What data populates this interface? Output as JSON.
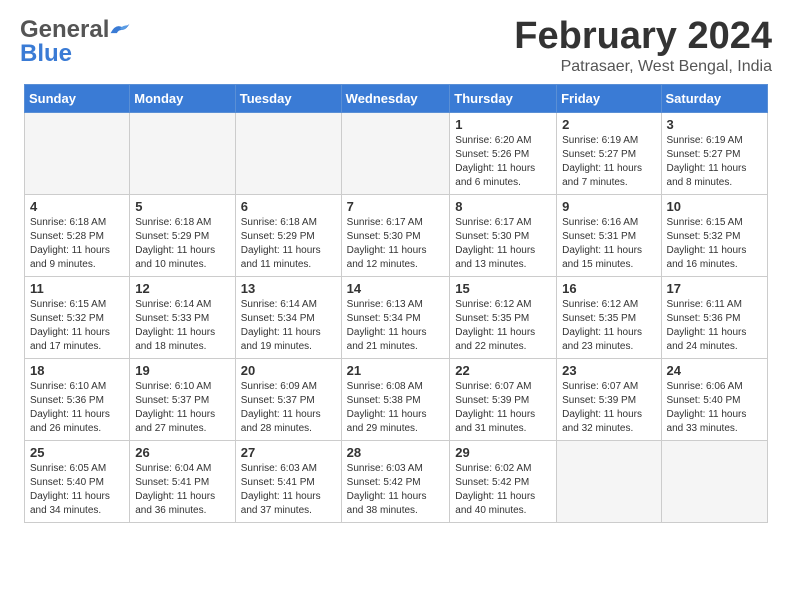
{
  "header": {
    "logo_line1": "General",
    "logo_line2": "Blue",
    "month_title": "February 2024",
    "location": "Patrasaer, West Bengal, India"
  },
  "weekdays": [
    "Sunday",
    "Monday",
    "Tuesday",
    "Wednesday",
    "Thursday",
    "Friday",
    "Saturday"
  ],
  "weeks": [
    [
      {
        "day": "",
        "info": ""
      },
      {
        "day": "",
        "info": ""
      },
      {
        "day": "",
        "info": ""
      },
      {
        "day": "",
        "info": ""
      },
      {
        "day": "1",
        "info": "Sunrise: 6:20 AM\nSunset: 5:26 PM\nDaylight: 11 hours\nand 6 minutes."
      },
      {
        "day": "2",
        "info": "Sunrise: 6:19 AM\nSunset: 5:27 PM\nDaylight: 11 hours\nand 7 minutes."
      },
      {
        "day": "3",
        "info": "Sunrise: 6:19 AM\nSunset: 5:27 PM\nDaylight: 11 hours\nand 8 minutes."
      }
    ],
    [
      {
        "day": "4",
        "info": "Sunrise: 6:18 AM\nSunset: 5:28 PM\nDaylight: 11 hours\nand 9 minutes."
      },
      {
        "day": "5",
        "info": "Sunrise: 6:18 AM\nSunset: 5:29 PM\nDaylight: 11 hours\nand 10 minutes."
      },
      {
        "day": "6",
        "info": "Sunrise: 6:18 AM\nSunset: 5:29 PM\nDaylight: 11 hours\nand 11 minutes."
      },
      {
        "day": "7",
        "info": "Sunrise: 6:17 AM\nSunset: 5:30 PM\nDaylight: 11 hours\nand 12 minutes."
      },
      {
        "day": "8",
        "info": "Sunrise: 6:17 AM\nSunset: 5:30 PM\nDaylight: 11 hours\nand 13 minutes."
      },
      {
        "day": "9",
        "info": "Sunrise: 6:16 AM\nSunset: 5:31 PM\nDaylight: 11 hours\nand 15 minutes."
      },
      {
        "day": "10",
        "info": "Sunrise: 6:15 AM\nSunset: 5:32 PM\nDaylight: 11 hours\nand 16 minutes."
      }
    ],
    [
      {
        "day": "11",
        "info": "Sunrise: 6:15 AM\nSunset: 5:32 PM\nDaylight: 11 hours\nand 17 minutes."
      },
      {
        "day": "12",
        "info": "Sunrise: 6:14 AM\nSunset: 5:33 PM\nDaylight: 11 hours\nand 18 minutes."
      },
      {
        "day": "13",
        "info": "Sunrise: 6:14 AM\nSunset: 5:34 PM\nDaylight: 11 hours\nand 19 minutes."
      },
      {
        "day": "14",
        "info": "Sunrise: 6:13 AM\nSunset: 5:34 PM\nDaylight: 11 hours\nand 21 minutes."
      },
      {
        "day": "15",
        "info": "Sunrise: 6:12 AM\nSunset: 5:35 PM\nDaylight: 11 hours\nand 22 minutes."
      },
      {
        "day": "16",
        "info": "Sunrise: 6:12 AM\nSunset: 5:35 PM\nDaylight: 11 hours\nand 23 minutes."
      },
      {
        "day": "17",
        "info": "Sunrise: 6:11 AM\nSunset: 5:36 PM\nDaylight: 11 hours\nand 24 minutes."
      }
    ],
    [
      {
        "day": "18",
        "info": "Sunrise: 6:10 AM\nSunset: 5:36 PM\nDaylight: 11 hours\nand 26 minutes."
      },
      {
        "day": "19",
        "info": "Sunrise: 6:10 AM\nSunset: 5:37 PM\nDaylight: 11 hours\nand 27 minutes."
      },
      {
        "day": "20",
        "info": "Sunrise: 6:09 AM\nSunset: 5:37 PM\nDaylight: 11 hours\nand 28 minutes."
      },
      {
        "day": "21",
        "info": "Sunrise: 6:08 AM\nSunset: 5:38 PM\nDaylight: 11 hours\nand 29 minutes."
      },
      {
        "day": "22",
        "info": "Sunrise: 6:07 AM\nSunset: 5:39 PM\nDaylight: 11 hours\nand 31 minutes."
      },
      {
        "day": "23",
        "info": "Sunrise: 6:07 AM\nSunset: 5:39 PM\nDaylight: 11 hours\nand 32 minutes."
      },
      {
        "day": "24",
        "info": "Sunrise: 6:06 AM\nSunset: 5:40 PM\nDaylight: 11 hours\nand 33 minutes."
      }
    ],
    [
      {
        "day": "25",
        "info": "Sunrise: 6:05 AM\nSunset: 5:40 PM\nDaylight: 11 hours\nand 34 minutes."
      },
      {
        "day": "26",
        "info": "Sunrise: 6:04 AM\nSunset: 5:41 PM\nDaylight: 11 hours\nand 36 minutes."
      },
      {
        "day": "27",
        "info": "Sunrise: 6:03 AM\nSunset: 5:41 PM\nDaylight: 11 hours\nand 37 minutes."
      },
      {
        "day": "28",
        "info": "Sunrise: 6:03 AM\nSunset: 5:42 PM\nDaylight: 11 hours\nand 38 minutes."
      },
      {
        "day": "29",
        "info": "Sunrise: 6:02 AM\nSunset: 5:42 PM\nDaylight: 11 hours\nand 40 minutes."
      },
      {
        "day": "",
        "info": ""
      },
      {
        "day": "",
        "info": ""
      }
    ]
  ]
}
